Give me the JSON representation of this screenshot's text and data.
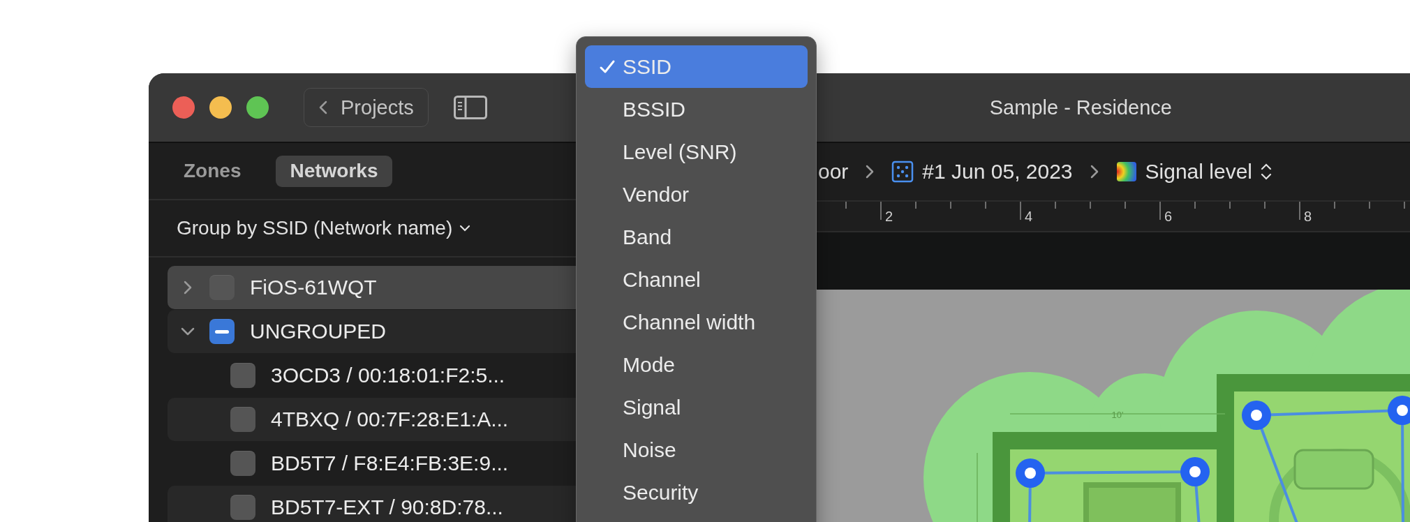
{
  "window": {
    "title": "Sample - Residence"
  },
  "toolbar": {
    "back_button": "Projects"
  },
  "sidebar": {
    "tabs": [
      {
        "label": "Zones",
        "selected": false
      },
      {
        "label": "Networks",
        "selected": true
      }
    ],
    "group_by": "Group by SSID (Network name)",
    "groups": [
      {
        "label": "FiOS-61WQT",
        "expanded": false,
        "checked": false,
        "selected": true
      },
      {
        "label": "UNGROUPED",
        "expanded": true,
        "checked": true,
        "mixed": true,
        "selected": false,
        "children": [
          {
            "label": "3OCD3 / 00:18:01:F2:5...",
            "checked": false
          },
          {
            "label": "4TBXQ / 00:7F:28:E1:A...",
            "checked": false
          },
          {
            "label": "BD5T7 / F8:E4:FB:3E:9...",
            "checked": false
          },
          {
            "label": "BD5T7-EXT / 90:8D:78...",
            "checked": false
          }
        ]
      }
    ]
  },
  "breadcrumb": [
    {
      "kind": "text",
      "label": "oor"
    },
    {
      "kind": "survey",
      "label": "#1 Jun 05, 2023"
    },
    {
      "kind": "visualization",
      "label": "Signal level"
    }
  ],
  "ruler": {
    "ticks": [
      "2",
      "4",
      "6",
      "8"
    ]
  },
  "canvas": {
    "dimension": "10'"
  },
  "menu": {
    "items": [
      {
        "label": "SSID",
        "selected": true
      },
      {
        "label": "BSSID",
        "selected": false
      },
      {
        "label": "Level (SNR)",
        "selected": false
      },
      {
        "label": "Vendor",
        "selected": false
      },
      {
        "label": "Band",
        "selected": false
      },
      {
        "label": "Channel",
        "selected": false
      },
      {
        "label": "Channel width",
        "selected": false
      },
      {
        "label": "Mode",
        "selected": false
      },
      {
        "label": "Signal",
        "selected": false
      },
      {
        "label": "Noise",
        "selected": false
      },
      {
        "label": "Security",
        "selected": false
      }
    ]
  }
}
